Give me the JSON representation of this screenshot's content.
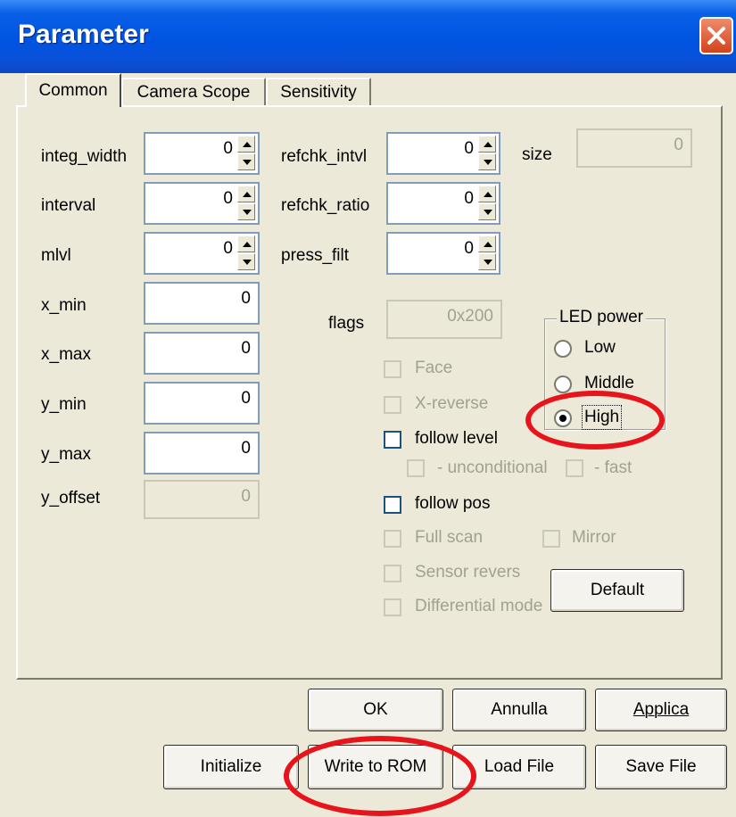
{
  "window": {
    "title": "Parameter"
  },
  "tabs": [
    {
      "label": "Common",
      "active": true
    },
    {
      "label": "Camera Scope",
      "active": false
    },
    {
      "label": "Sensitivity",
      "active": false
    }
  ],
  "left_fields": [
    {
      "label": "integ_width",
      "value": "0",
      "spinner": true
    },
    {
      "label": "interval",
      "value": "0",
      "spinner": true
    },
    {
      "label": "mlvl",
      "value": "0",
      "spinner": true
    },
    {
      "label": "x_min",
      "value": "0",
      "spinner": false
    },
    {
      "label": "x_max",
      "value": "0",
      "spinner": false
    },
    {
      "label": "y_min",
      "value": "0",
      "spinner": false
    },
    {
      "label": "y_max",
      "value": "0",
      "spinner": false
    },
    {
      "label": "y_offset",
      "value": "0",
      "spinner": false,
      "disabled": true
    }
  ],
  "mid_fields": [
    {
      "label": "refchk_intvl",
      "value": "0"
    },
    {
      "label": "refchk_ratio",
      "value": "0"
    },
    {
      "label": "press_filt",
      "value": "0"
    }
  ],
  "size_field": {
    "label": "size",
    "value": "0"
  },
  "flags_field": {
    "label": "flags",
    "value": "0x200"
  },
  "checkboxes": {
    "face": "Face",
    "x_reverse": "X-reverse",
    "follow_level": "follow level",
    "unconditional": "- unconditional",
    "fast": "- fast",
    "follow_pos": "follow pos",
    "full_scan": "Full scan",
    "mirror": "Mirror",
    "sensor_revers": "Sensor revers",
    "differential_mode": "Differential mode"
  },
  "led_power": {
    "label": "LED power",
    "options": [
      "Low",
      "Middle",
      "High"
    ],
    "selected": "High"
  },
  "buttons": {
    "default": "Default",
    "ok": "OK",
    "cancel": "Annulla",
    "apply": "Applica",
    "initialize": "Initialize",
    "write_rom": "Write to ROM",
    "load_file": "Load File",
    "save_file": "Save File"
  },
  "highlight_color": "#e8141c"
}
